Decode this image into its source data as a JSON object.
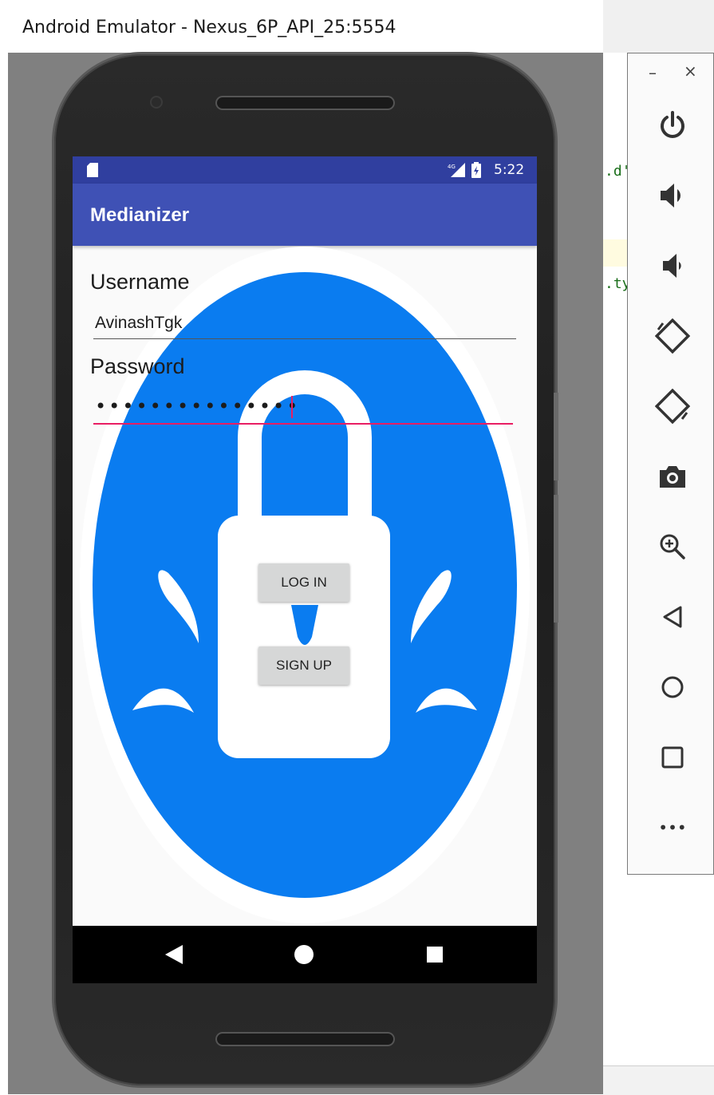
{
  "window": {
    "title": "Android Emulator - Nexus_6P_API_25:5554"
  },
  "status_bar": {
    "time": "5:22",
    "network": "4G"
  },
  "app": {
    "title": "Medianizer",
    "username_label": "Username",
    "username_value": "AvinashTgk",
    "password_label": "Password",
    "password_value": "•••••••••••••••",
    "login_label": "LOG IN",
    "signup_label": "SIGN UP"
  },
  "ide": {
    "code_line_1": ".d'",
    "code_line_2": ".ty"
  },
  "toolbar": {
    "minimize_label": "–",
    "close_label": "×",
    "items": [
      {
        "name": "power-icon"
      },
      {
        "name": "volume-up-icon"
      },
      {
        "name": "volume-down-icon"
      },
      {
        "name": "rotate-left-icon"
      },
      {
        "name": "rotate-right-icon"
      },
      {
        "name": "camera-icon"
      },
      {
        "name": "zoom-icon"
      },
      {
        "name": "back-icon"
      },
      {
        "name": "home-icon"
      },
      {
        "name": "overview-icon"
      },
      {
        "name": "more-icon"
      }
    ],
    "more_label": "•••"
  },
  "colors": {
    "status_bar": "#303f9f",
    "app_bar": "#3f51b5",
    "accent": "#e91e63",
    "lock_blue": "#0a7cf0"
  }
}
